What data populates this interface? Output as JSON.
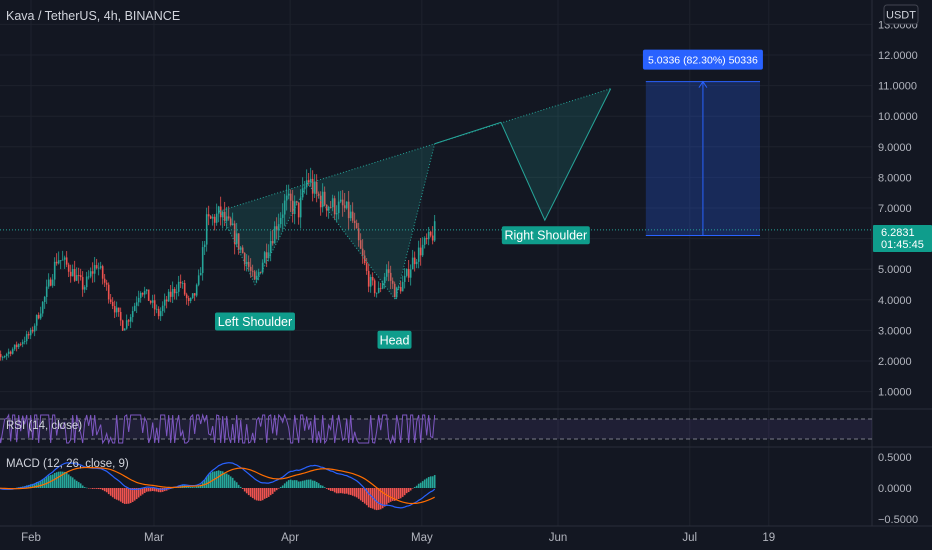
{
  "header": {
    "title": "Kava / TetherUS, 4h, BINANCE",
    "currency_button": "USDT"
  },
  "price_pane": {
    "y_ticks": [
      1,
      2,
      3,
      4,
      5,
      6,
      7,
      8,
      9,
      10,
      11,
      12,
      13
    ],
    "y_tick_labels": [
      "1.0000",
      "2.0000",
      "3.0000",
      "4.0000",
      "5.0000",
      "6.0000",
      "7.0000",
      "8.0000",
      "9.0000",
      "10.0000",
      "11.0000",
      "12.0000",
      "13.0000"
    ],
    "current_price": "6.2831",
    "countdown": "01:45:45"
  },
  "rsi_pane": {
    "label": "RSI (14, close)",
    "upper_band": 70,
    "lower_band": 30
  },
  "macd_pane": {
    "label": "MACD (12, 26, close, 9)",
    "y_ticks": [
      0.5,
      0,
      -0.5
    ],
    "y_tick_labels": [
      "0.5000",
      "0.0000",
      "−0.5000"
    ]
  },
  "x_axis": {
    "labels": [
      "Feb",
      "Mar",
      "Apr",
      "May",
      "Jun",
      "Jul",
      "19"
    ]
  },
  "annotations": {
    "left_shoulder": "Left Shoulder",
    "head": "Head",
    "right_shoulder": "Right Shoulder",
    "measure": "5.0336 (82.30%) 50336"
  },
  "colors": {
    "background": "#131722",
    "grid": "#1e222d",
    "up": "#26a69a",
    "down": "#ef5350",
    "label_fill": "#0f9d8c",
    "measure_fill": "#2962ff",
    "rsi_line": "#7e57c2",
    "macd_line": "#2962ff",
    "signal_line": "#ff6d00"
  },
  "chart_data": {
    "type": "candlestick",
    "symbol": "Kava / TetherUS",
    "interval": "4h",
    "exchange": "BINANCE",
    "price_path": [
      [
        "2022-01-21",
        2.5
      ],
      [
        "2022-01-25",
        2.1
      ],
      [
        "2022-01-28",
        2.4
      ],
      [
        "2022-02-01",
        2.9
      ],
      [
        "2022-02-04",
        4.0
      ],
      [
        "2022-02-07",
        5.4
      ],
      [
        "2022-02-10",
        5.0
      ],
      [
        "2022-02-13",
        4.4
      ],
      [
        "2022-02-16",
        5.2
      ],
      [
        "2022-02-19",
        4.1
      ],
      [
        "2022-02-22",
        3.1
      ],
      [
        "2022-02-24",
        3.6
      ],
      [
        "2022-02-26",
        4.4
      ],
      [
        "2022-02-28",
        4.0
      ],
      [
        "2022-03-02",
        3.5
      ],
      [
        "2022-03-04",
        4.0
      ],
      [
        "2022-03-07",
        4.6
      ],
      [
        "2022-03-09",
        3.8
      ],
      [
        "2022-03-11",
        4.4
      ],
      [
        "2022-03-13",
        6.5
      ],
      [
        "2022-03-16",
        6.8
      ],
      [
        "2022-03-19",
        6.2
      ],
      [
        "2022-03-22",
        5.3
      ],
      [
        "2022-03-24",
        4.5
      ],
      [
        "2022-03-26",
        5.4
      ],
      [
        "2022-03-29",
        6.5
      ],
      [
        "2022-03-31",
        7.2
      ],
      [
        "2022-04-03",
        6.9
      ],
      [
        "2022-04-05",
        8.0
      ],
      [
        "2022-04-07",
        7.4
      ],
      [
        "2022-04-10",
        7.1
      ],
      [
        "2022-04-13",
        7.0
      ],
      [
        "2022-04-15",
        6.7
      ],
      [
        "2022-04-17",
        5.6
      ],
      [
        "2022-04-19",
        4.6
      ],
      [
        "2022-04-21",
        4.2
      ],
      [
        "2022-04-23",
        5.0
      ],
      [
        "2022-04-25",
        4.2
      ],
      [
        "2022-04-27",
        4.6
      ],
      [
        "2022-04-29",
        5.3
      ],
      [
        "2022-05-01",
        5.7
      ],
      [
        "2022-05-03",
        6.0
      ],
      [
        "2022-05-04",
        6.28
      ]
    ],
    "pattern_points": {
      "left_shoulder": [
        "2022-03-24",
        4.5
      ],
      "head": [
        "2022-04-25",
        4.0
      ],
      "right_shoulder_target": [
        "2022-05-29",
        6.6
      ],
      "neckline_start": [
        "2022-03-16",
        6.9
      ],
      "neckline_end": [
        "2022-06-13",
        10.9
      ],
      "projection_peak": [
        "2022-05-19",
        9.8
      ]
    },
    "measure_box": {
      "x_start": "2022-06-21",
      "x_end": "2022-07-17",
      "y_bottom": 6.1,
      "y_top": 11.13
    },
    "price_ylim": [
      0.5,
      13.5
    ],
    "macd_ylim": [
      -0.6,
      0.62
    ],
    "rsi_ylim": [
      0,
      100
    ],
    "x_tick_dates": [
      "2022-02-01",
      "2022-03-01",
      "2022-04-01",
      "2022-05-01",
      "2022-06-01",
      "2022-07-01",
      "2022-07-19"
    ]
  }
}
